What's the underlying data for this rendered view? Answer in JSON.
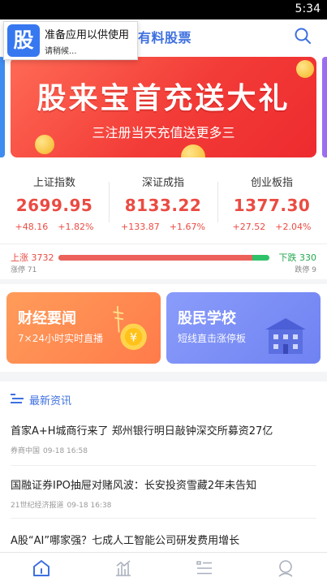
{
  "status_bar": {
    "time": "5:34"
  },
  "header": {
    "title": "有料股票"
  },
  "toast": {
    "icon_char": "股",
    "title": "准备应用以供使用",
    "subtitle": "请稍候..."
  },
  "banner": {
    "title": "股来宝首充送大礼",
    "subtitle": "三注册当天充值送更多三"
  },
  "indices": [
    {
      "name": "上证指数",
      "value": "2699.95",
      "change": "+48.16",
      "percent": "+1.82%"
    },
    {
      "name": "深证成指",
      "value": "8133.22",
      "change": "+133.87",
      "percent": "+1.67%"
    },
    {
      "name": "创业板指",
      "value": "1377.30",
      "change": "+27.52",
      "percent": "+2.04%"
    }
  ],
  "market_breadth": {
    "up_label": "上涨 3732",
    "down_label": "下跌 330",
    "limit_up_label": "涨停 71",
    "limit_down_label": "跌停 9",
    "up_ratio": 0.919,
    "up_color": "#ec615a",
    "down_color": "#2ec26a"
  },
  "features": [
    {
      "title": "财经要闻",
      "subtitle": "7×24小时实时直播"
    },
    {
      "title": "股民学校",
      "subtitle": "短线直击涨停板"
    }
  ],
  "news": {
    "section_title": "最新资讯",
    "items": [
      {
        "title": "首家A+H城商行来了 郑州银行明日敲钟深交所募资27亿",
        "source": "券商中国",
        "time": "09-18 16:58"
      },
      {
        "title": "国融证券IPO抽屉对赌风波：长安投资雪藏2年未告知",
        "source": "21世纪经济报道",
        "time": "09-18 16:38"
      },
      {
        "title": "A股“AI”哪家强？七成人工智能公司研发费用增长",
        "source": "",
        "time": ""
      }
    ]
  },
  "nav": {
    "items": [
      {
        "icon": "home-icon"
      },
      {
        "icon": "chart-icon"
      },
      {
        "icon": "list-icon"
      },
      {
        "icon": "profile-icon"
      }
    ]
  },
  "colors": {
    "accent": "#3d6fe0",
    "rise": "#ea4b43",
    "fall": "#23a950"
  }
}
